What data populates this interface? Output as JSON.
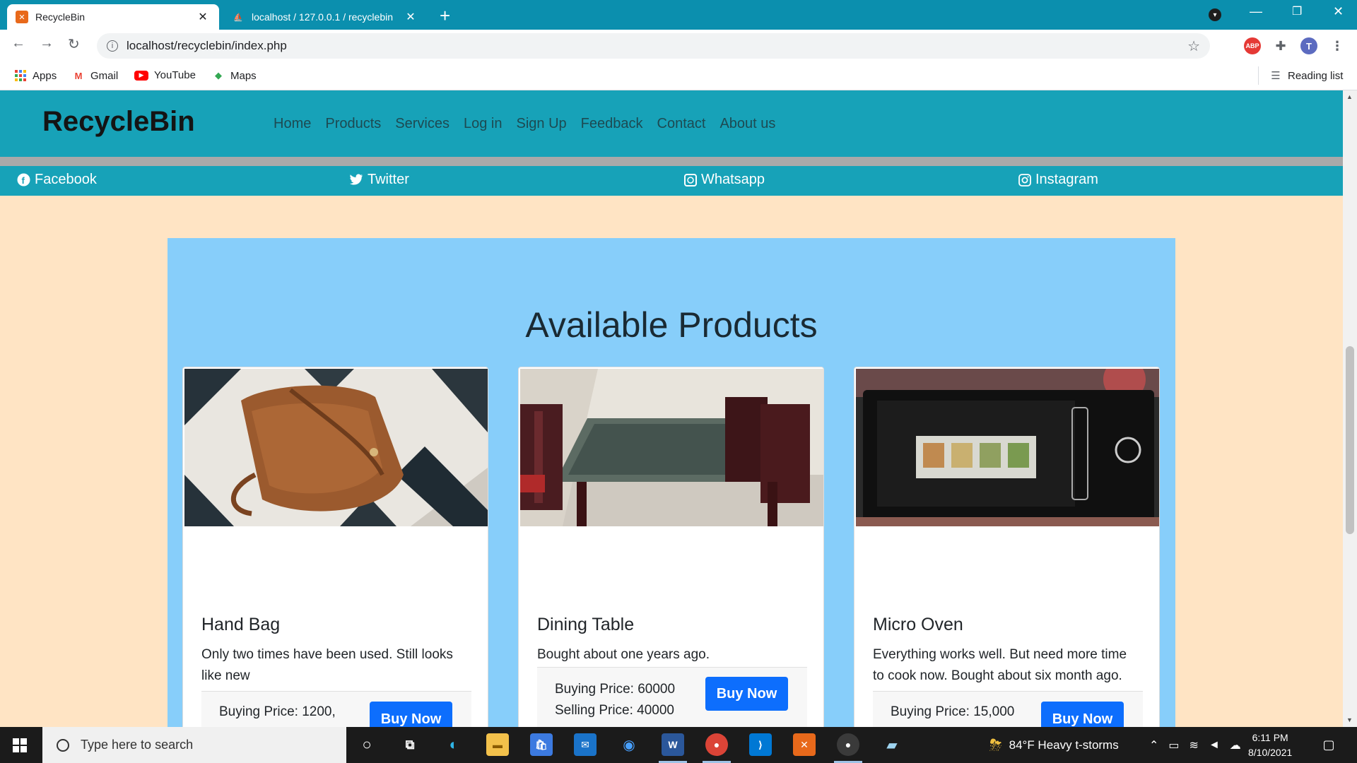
{
  "browser": {
    "tabs": [
      {
        "title": "RecycleBin",
        "active": true,
        "icon": "xampp-icon"
      },
      {
        "title": "localhost / 127.0.0.1 / recyclebin",
        "active": false,
        "icon": "phpmyadmin-icon"
      }
    ],
    "address": "localhost/recyclebin/index.php",
    "profile_initial": "T",
    "ext_abp": "ABP",
    "bookmarks": [
      {
        "label": "Apps",
        "icon": "apps-grid-icon"
      },
      {
        "label": "Gmail",
        "icon": "gmail-icon"
      },
      {
        "label": "YouTube",
        "icon": "youtube-icon"
      },
      {
        "label": "Maps",
        "icon": "maps-icon"
      }
    ],
    "reading_list": "Reading list"
  },
  "site": {
    "brand": "RecycleBin",
    "menu": [
      "Home",
      "Products",
      "Services",
      "Log in",
      "Sign Up",
      "Feedback",
      "Contact",
      "About us"
    ],
    "social": [
      "Facebook",
      "Twitter",
      "Whatsapp",
      "Instagram"
    ],
    "products_heading": "Available Products",
    "products": [
      {
        "name": "Hand Bag",
        "description": "Only two times have been used. Still looks like new",
        "buying_price": "Buying Price: 1200,",
        "selling_price": "",
        "buy_label": "Buy Now"
      },
      {
        "name": "Dining Table",
        "description": "Bought about one years ago.",
        "buying_price": "Buying Price: 60000",
        "selling_price": "Selling Price: 40000",
        "buy_label": "Buy Now"
      },
      {
        "name": "Micro Oven",
        "description": "Everything works well. But need more time to cook now. Bought about six month ago.",
        "buying_price": "Buying Price: 15,000",
        "selling_price": "",
        "buy_label": "Buy Now"
      }
    ]
  },
  "taskbar": {
    "search_placeholder": "Type here to search",
    "weather": "84°F  Heavy t-storms",
    "time": "6:11 PM",
    "date": "8/10/2021"
  },
  "colors": {
    "browser_frame": "#0b8fae",
    "site_nav": "#17a2b8",
    "page_bg": "#ffe4c4",
    "products_bg": "#87cefa",
    "buy_button": "#0d6efd"
  }
}
